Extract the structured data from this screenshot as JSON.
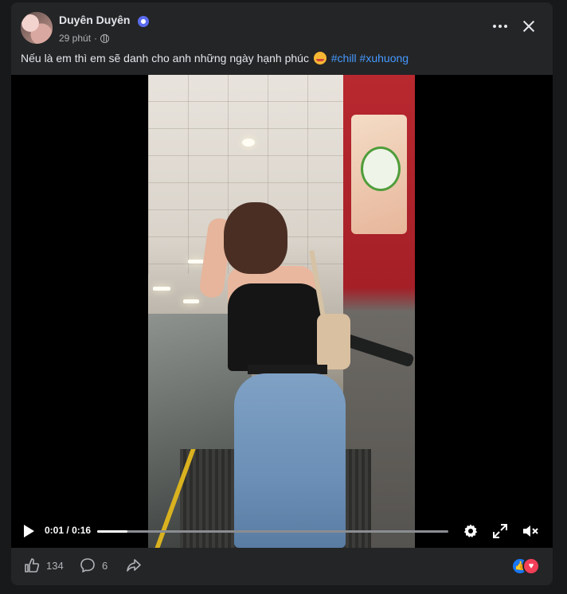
{
  "post": {
    "author": "Duyên Duyên",
    "time": "29 phút",
    "caption_text": "Nếu là em thì em sẽ danh cho anh những ngày hạnh phúc",
    "hashtags": [
      "#chill",
      "#xuhuong"
    ]
  },
  "video": {
    "current_time": "0:01",
    "duration": "0:16",
    "time_separator": "/",
    "progress_fraction": 0.086
  },
  "reactions": {
    "like_count": "134",
    "comment_count": "6"
  },
  "icons": {
    "header": [
      "verified-badge-icon",
      "globe-icon",
      "more-icon",
      "close-icon"
    ],
    "player": [
      "play-icon",
      "settings-gear-icon",
      "fullscreen-icon",
      "mute-icon"
    ],
    "footer": [
      "like-icon",
      "comment-icon",
      "share-icon",
      "like-reaction-icon",
      "love-reaction-icon"
    ]
  },
  "colors": {
    "card_background": "#242526",
    "page_background": "#18191a",
    "hashtag": "#4599ff",
    "text_primary": "#e4e6eb",
    "text_secondary": "#b0b3b8"
  }
}
